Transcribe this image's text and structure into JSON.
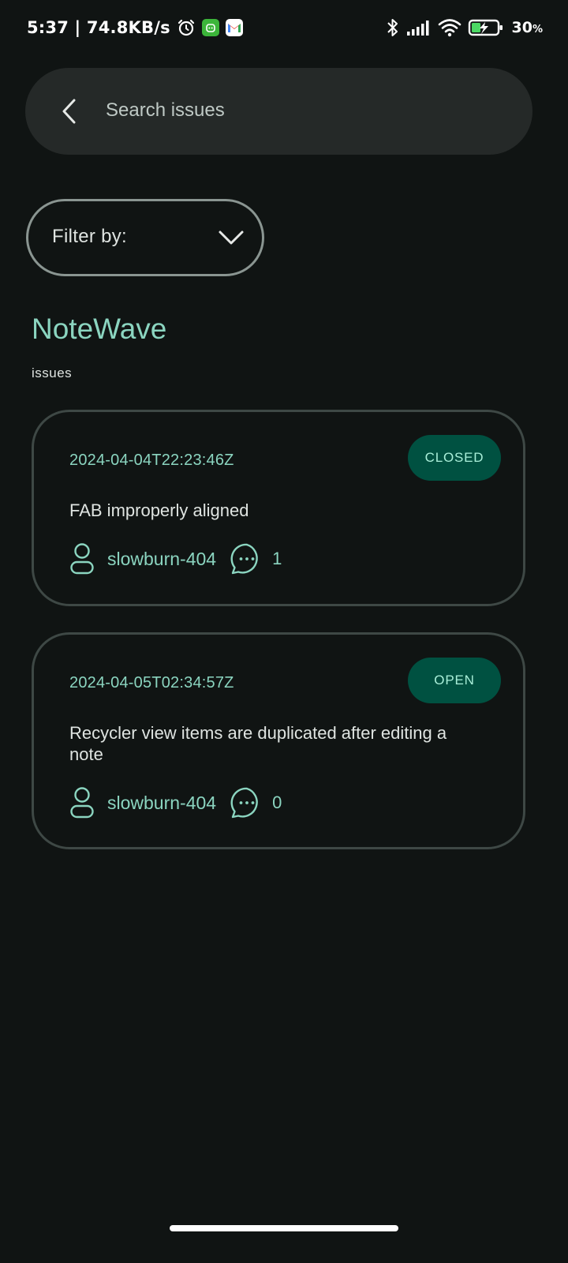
{
  "status_bar": {
    "time": "5:37 | 74.8KB/s",
    "battery_percent": "30",
    "battery_unit": "%",
    "icons": [
      "alarm-icon",
      "app-badge-icon",
      "gmail-icon",
      "bluetooth-icon",
      "signal-icon",
      "wifi-icon",
      "battery-charging-icon"
    ]
  },
  "search": {
    "placeholder": "Search issues",
    "back_icon": "chevron-left-icon"
  },
  "filter": {
    "label": "Filter by:",
    "icon": "chevron-down-icon"
  },
  "repo": {
    "name": "NoteWave",
    "subtitle": "issues"
  },
  "issues": [
    {
      "date": "2024-04-04T22:23:46Z",
      "status": "CLOSED",
      "title": "FAB improperly aligned",
      "author": "slowburn-404",
      "comments": "1"
    },
    {
      "date": "2024-04-05T02:34:57Z",
      "status": "OPEN",
      "title": "Recycler view items are duplicated after editing a note",
      "author": "slowburn-404",
      "comments": "0"
    }
  ],
  "colors": {
    "background": "#101413",
    "accent": "#8bd5c0",
    "badge_bg": "#005141",
    "card_border": "#3e4845",
    "search_bg": "#252928"
  }
}
